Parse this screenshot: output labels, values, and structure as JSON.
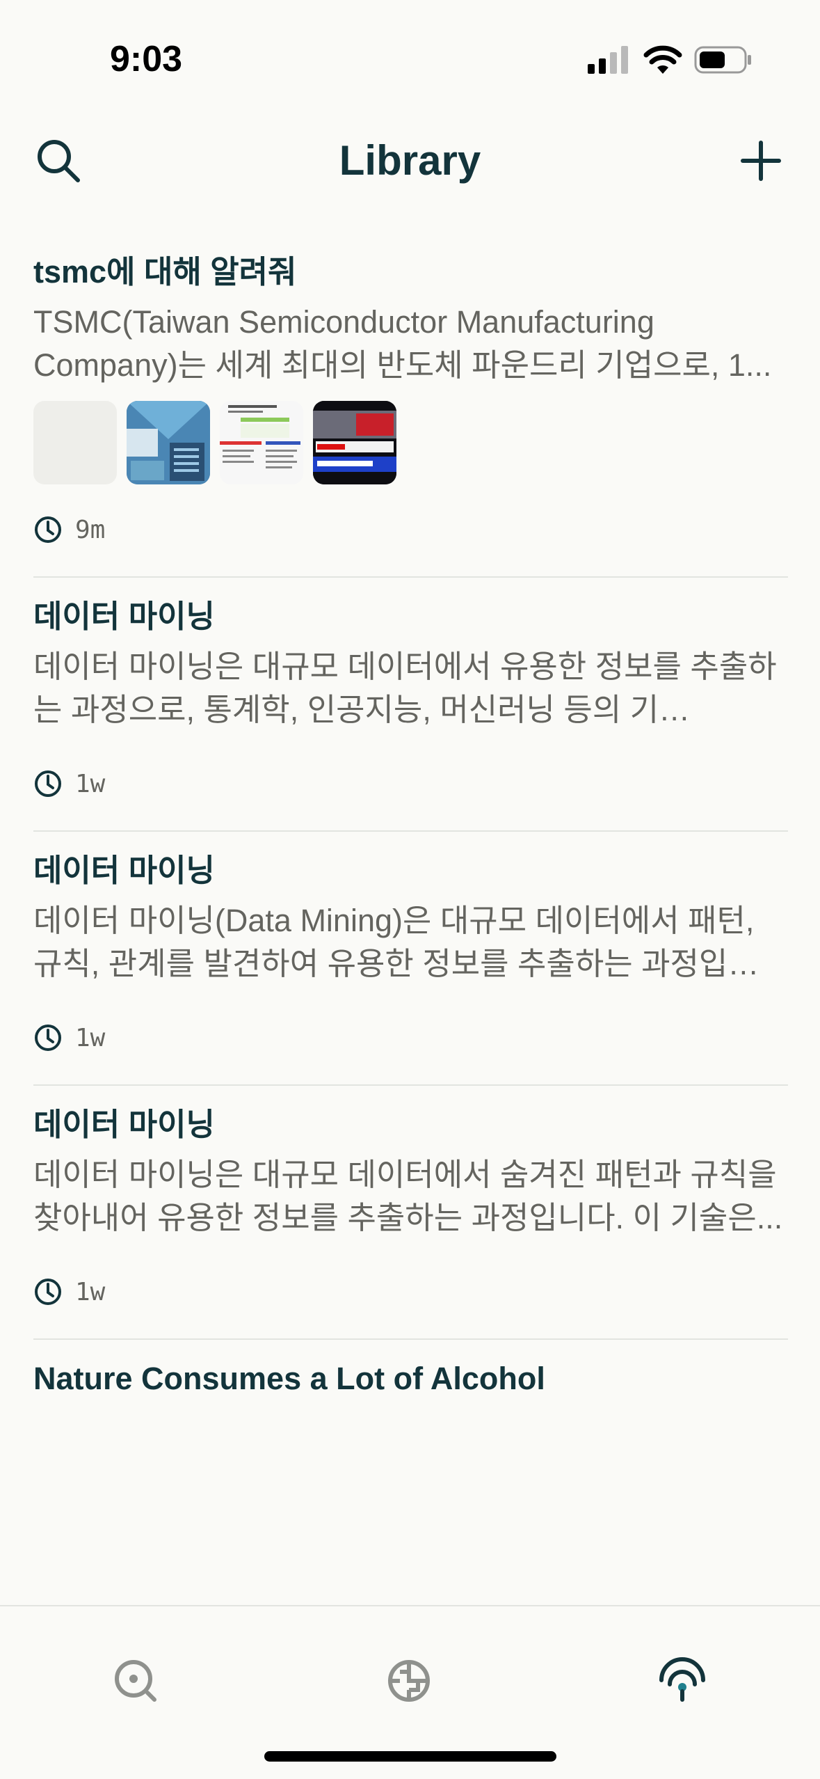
{
  "status_bar": {
    "time": "9:03"
  },
  "header": {
    "title": "Library"
  },
  "threads": [
    {
      "title": "tsmc에 대해 알려줘",
      "snippet": "TSMC(Taiwan Semiconductor Manufacturing Company)는 세계 최대의 반도체 파운드리 기업으로, 1...",
      "time": "9m",
      "thumbnails": [
        "blank",
        "intel-chart",
        "document-table",
        "news-video"
      ]
    },
    {
      "title": "데이터 마이닝",
      "snippet": "데이터 마이닝은 대규모 데이터에서 유용한 정보를 추출하는 과정으로, 통계학, 인공지능, 머신러닝 등의 기…",
      "time": "1w"
    },
    {
      "title": "데이터 마이닝",
      "snippet": "데이터 마이닝(Data Mining)은 대규모 데이터에서 패턴, 규칙, 관계를 발견하여 유용한 정보를 추출하는 과정입…",
      "time": "1w"
    },
    {
      "title": "데이터 마이닝",
      "snippet": "데이터 마이닝은 대규모 데이터에서 숨겨진 패턴과 규칙을 찾아내어 유용한 정보를 추출하는 과정입니다. 이 기술은...",
      "time": "1w"
    },
    {
      "title": "Nature Consumes a Lot of Alcohol"
    }
  ],
  "nav": {
    "items": [
      {
        "icon": "discover-icon"
      },
      {
        "icon": "spaces-icon"
      },
      {
        "icon": "library-icon",
        "active": true
      }
    ]
  },
  "colors": {
    "text": "#13343b",
    "muted": "#64645f",
    "background": "#fafaf7",
    "divider": "#e2e4e0"
  }
}
